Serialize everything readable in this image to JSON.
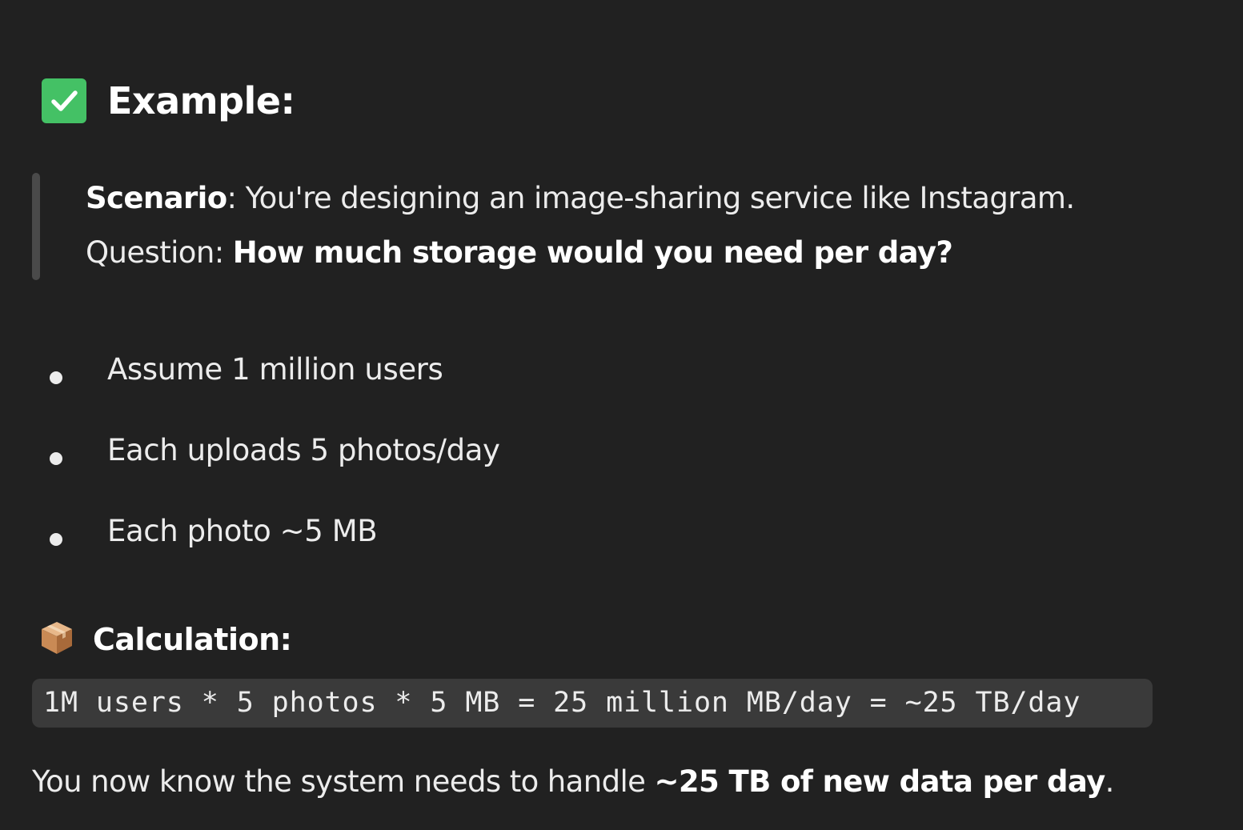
{
  "example": {
    "icon": "check-mark-button-icon",
    "title": "Example:"
  },
  "quote": {
    "scenario_label": "Scenario",
    "scenario_text": ": You're designing an image-sharing service like Instagram.",
    "question_label": "Question: ",
    "question_text": "How much storage would you need per day?"
  },
  "assumptions": [
    "Assume 1 million users",
    "Each uploads 5 photos/day",
    "Each photo ~5 MB"
  ],
  "calculation": {
    "icon": "package-icon",
    "title": "Calculation:",
    "code": "1M users * 5 photos * 5 MB = 25 million MB/day = ~25 TB/day"
  },
  "conclusion": {
    "prefix": "You now know the system needs to handle ",
    "bold": "~25 TB of new data per day",
    "suffix": "."
  },
  "colors": {
    "background": "#212121",
    "check_green": "#44c165",
    "code_bg": "#3a3a3a",
    "quote_bar": "#4a4a4a"
  }
}
